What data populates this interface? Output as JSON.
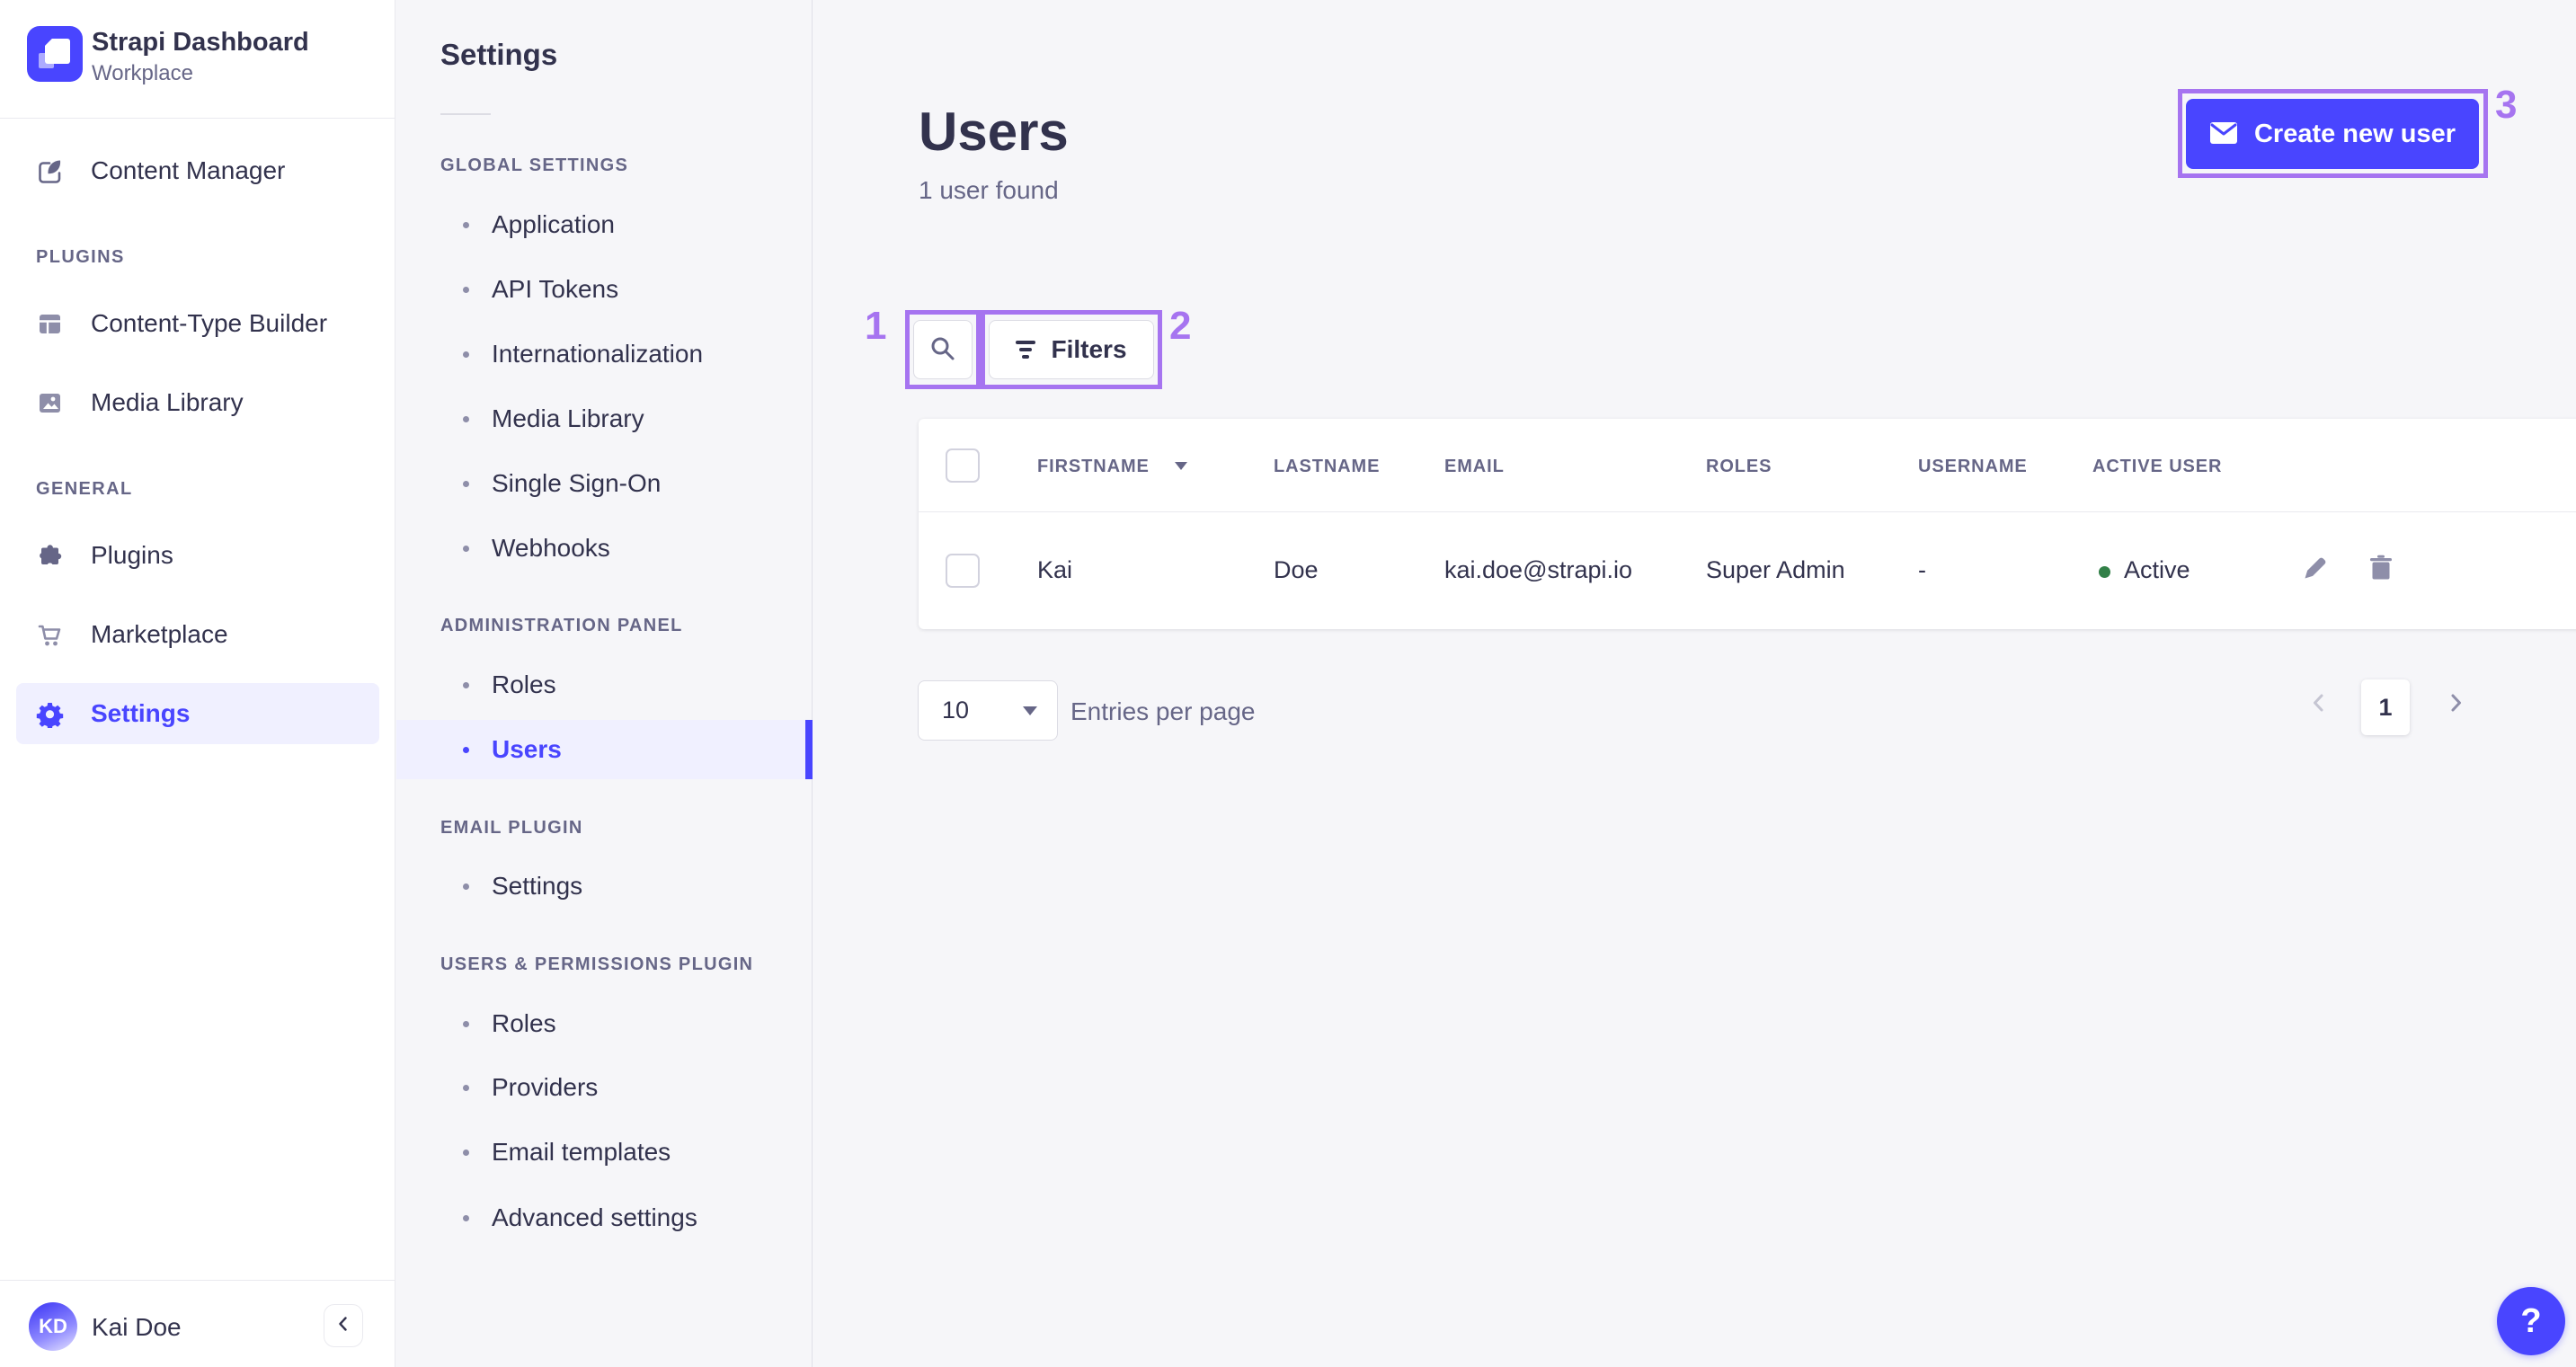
{
  "colors": {
    "accent": "#4945ff",
    "accent_light": "#f0f0ff",
    "annotation": "#a674f0",
    "success_dot": "#328048"
  },
  "sidebar": {
    "logo_title": "Strapi Dashboard",
    "logo_subtitle": "Workplace",
    "top_item": "Content Manager",
    "sections": [
      {
        "title": "PLUGINS",
        "items": [
          {
            "label": "Content-Type Builder"
          },
          {
            "label": "Media Library"
          }
        ]
      },
      {
        "title": "GENERAL",
        "items": [
          {
            "label": "Plugins"
          },
          {
            "label": "Marketplace"
          },
          {
            "label": "Settings"
          }
        ]
      }
    ],
    "user": {
      "initials": "KD",
      "name": "Kai Doe"
    }
  },
  "subnav": {
    "title": "Settings",
    "sections": [
      {
        "title": "GLOBAL SETTINGS",
        "items": [
          "Application",
          "API Tokens",
          "Internationalization",
          "Media Library",
          "Single Sign-On",
          "Webhooks"
        ]
      },
      {
        "title": "ADMINISTRATION PANEL",
        "items": [
          "Roles",
          "Users"
        ]
      },
      {
        "title": "EMAIL PLUGIN",
        "items": [
          "Settings"
        ]
      },
      {
        "title": "USERS & PERMISSIONS PLUGIN",
        "items": [
          "Roles",
          "Providers",
          "Email templates",
          "Advanced settings"
        ]
      }
    ]
  },
  "main": {
    "title": "Users",
    "subtitle": "1 user found",
    "create_button": "Create new user",
    "filters_button": "Filters",
    "table": {
      "headers": [
        "FIRSTNAME",
        "LASTNAME",
        "EMAIL",
        "ROLES",
        "USERNAME",
        "ACTIVE USER"
      ],
      "rows": [
        {
          "firstname": "Kai",
          "lastname": "Doe",
          "email": "kai.doe@strapi.io",
          "roles": "Super Admin",
          "username": "-",
          "status": "Active"
        }
      ]
    },
    "pagination": {
      "entries_value": "10",
      "entries_label": "Entries per page",
      "page": "1"
    }
  },
  "annotations": {
    "n1": "1",
    "n2": "2",
    "n3": "3"
  },
  "help": {
    "label": "?"
  }
}
